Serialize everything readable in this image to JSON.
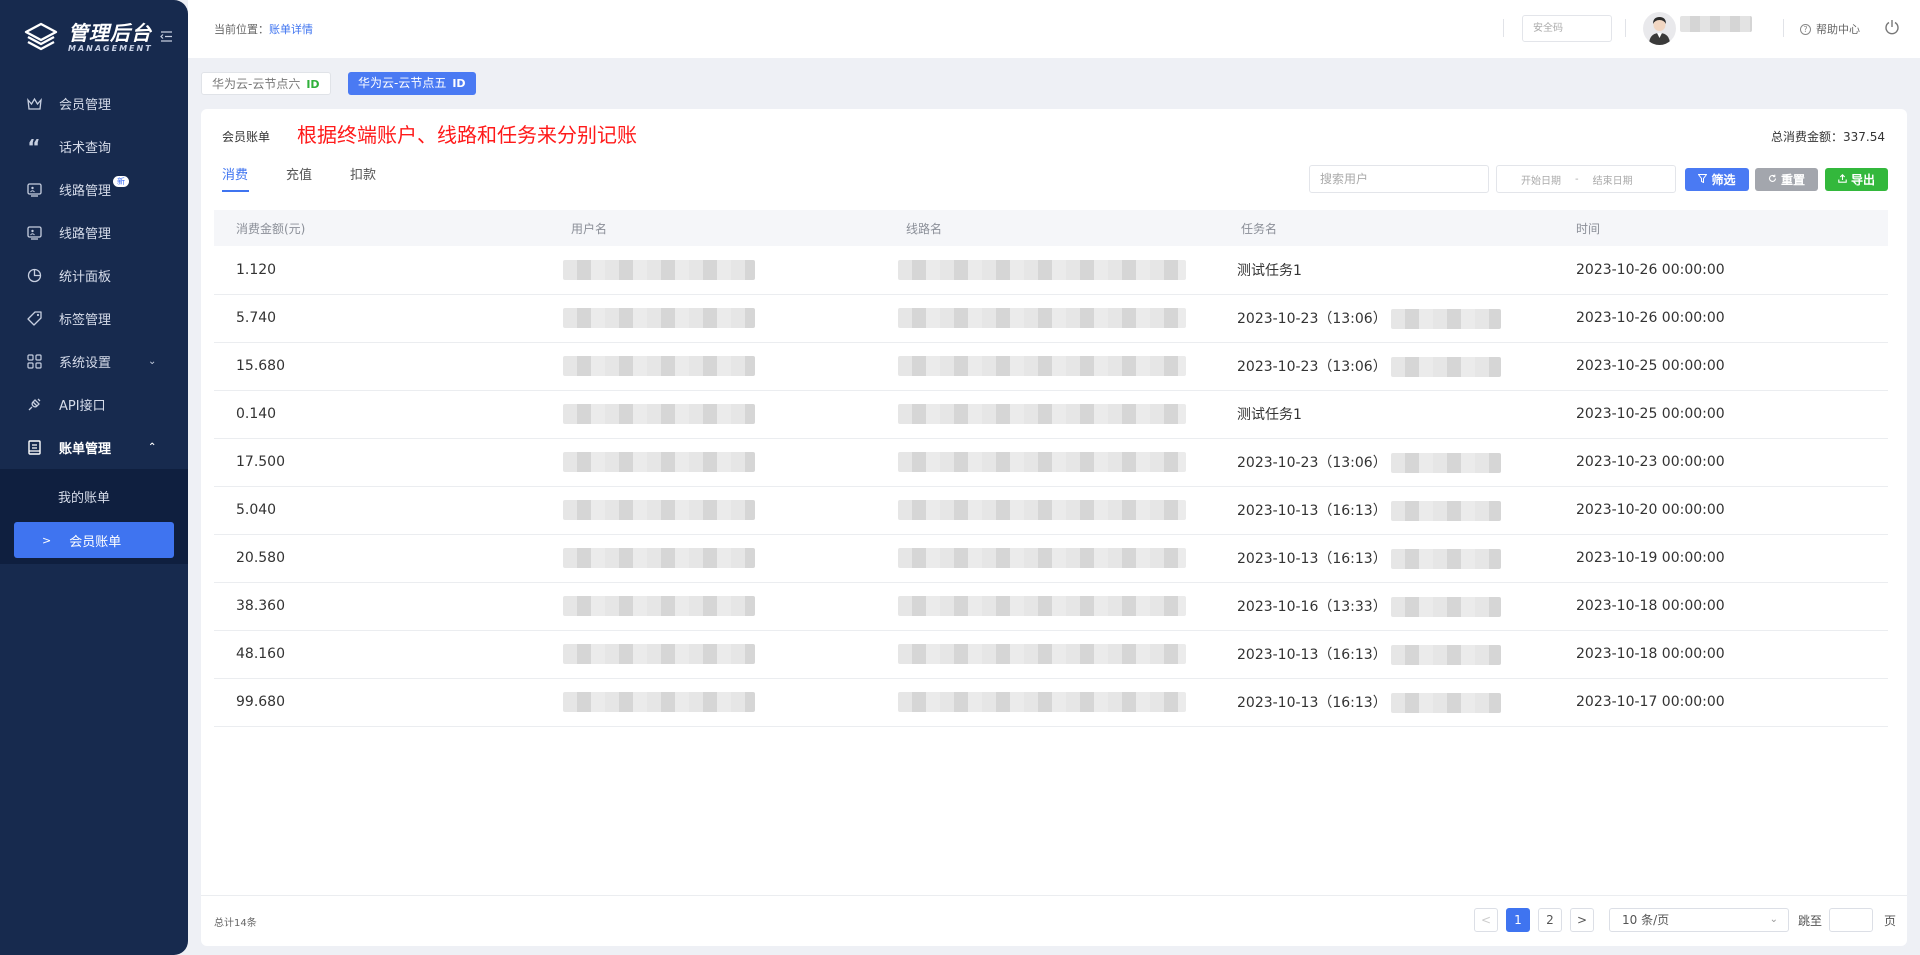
{
  "app": {
    "title": "管理后台",
    "subtitle": "MANAGEMENT"
  },
  "sidebar": {
    "items": [
      {
        "label": "会员管理",
        "icon": "crown-icon"
      },
      {
        "label": "话术查询",
        "icon": "quote-icon"
      },
      {
        "label": "线路管理",
        "icon": "monitor-icon",
        "badge": "新"
      },
      {
        "label": "线路管理",
        "icon": "monitor-icon"
      },
      {
        "label": "统计面板",
        "icon": "pie-chart-icon"
      },
      {
        "label": "标签管理",
        "icon": "tag-icon"
      },
      {
        "label": "系统设置",
        "icon": "grid-icon"
      },
      {
        "label": "API接口",
        "icon": "plug-icon"
      },
      {
        "label": "账单管理",
        "icon": "bill-icon"
      }
    ],
    "submenu": [
      {
        "label": "我的账单"
      },
      {
        "label": "会员账单"
      }
    ]
  },
  "header": {
    "breadcrumb_prefix": "当前位置：",
    "breadcrumb_current": "账单详情",
    "safe_code_placeholder": "安全码",
    "help": "帮助中心"
  },
  "nodes": [
    {
      "label": "华为云-云节点六",
      "id": "ID"
    },
    {
      "label": "华为云-云节点五",
      "id": "ID"
    }
  ],
  "card": {
    "title": "会员账单",
    "note": "根据终端账户、线路和任务来分别记账",
    "total_label": "总消费金额：",
    "total_value": "337.54"
  },
  "tabs": [
    "消费",
    "充值",
    "扣款"
  ],
  "filters": {
    "search_placeholder": "搜索用户",
    "start_date": "开始日期",
    "end_date": "结束日期",
    "range_sep": "-",
    "filter_btn": "筛选",
    "reset_btn": "重置",
    "export_btn": "导出"
  },
  "table": {
    "headers": [
      "消费金额(元)",
      "用户名",
      "线路名",
      "任务名",
      "时间"
    ],
    "rows": [
      {
        "amount": "1.120",
        "task": "测试任务1",
        "task_blur": false,
        "time": "2023-10-26 00:00:00"
      },
      {
        "amount": "5.740",
        "task": "2023-10-23（13:06）",
        "task_blur": true,
        "time": "2023-10-26 00:00:00"
      },
      {
        "amount": "15.680",
        "task": "2023-10-23（13:06）",
        "task_blur": true,
        "time": "2023-10-25 00:00:00"
      },
      {
        "amount": "0.140",
        "task": "测试任务1",
        "task_blur": false,
        "time": "2023-10-25 00:00:00"
      },
      {
        "amount": "17.500",
        "task": "2023-10-23（13:06）",
        "task_blur": true,
        "time": "2023-10-23 00:00:00"
      },
      {
        "amount": "5.040",
        "task": "2023-10-13（16:13）",
        "task_blur": true,
        "time": "2023-10-20 00:00:00"
      },
      {
        "amount": "20.580",
        "task": "2023-10-13（16:13）",
        "task_blur": true,
        "time": "2023-10-19 00:00:00"
      },
      {
        "amount": "38.360",
        "task": "2023-10-16（13:33）",
        "task_blur": true,
        "time": "2023-10-18 00:00:00"
      },
      {
        "amount": "48.160",
        "task": "2023-10-13（16:13）",
        "task_blur": true,
        "time": "2023-10-18 00:00:00"
      },
      {
        "amount": "99.680",
        "task": "2023-10-13（16:13）",
        "task_blur": true,
        "time": "2023-10-17 00:00:00"
      }
    ]
  },
  "footer": {
    "total_count": "总计14条",
    "pages": [
      "1",
      "2"
    ],
    "prev": "<",
    "next": ">",
    "page_size": "10 条/页",
    "jump_label": "跳至",
    "jump_unit": "页"
  },
  "colors": {
    "sidebar_bg": "#172a4e",
    "accent": "#3f74f0",
    "note_red": "#ff1a1a",
    "export_green": "#33b83c",
    "reset_gray": "#a3a6ad"
  }
}
